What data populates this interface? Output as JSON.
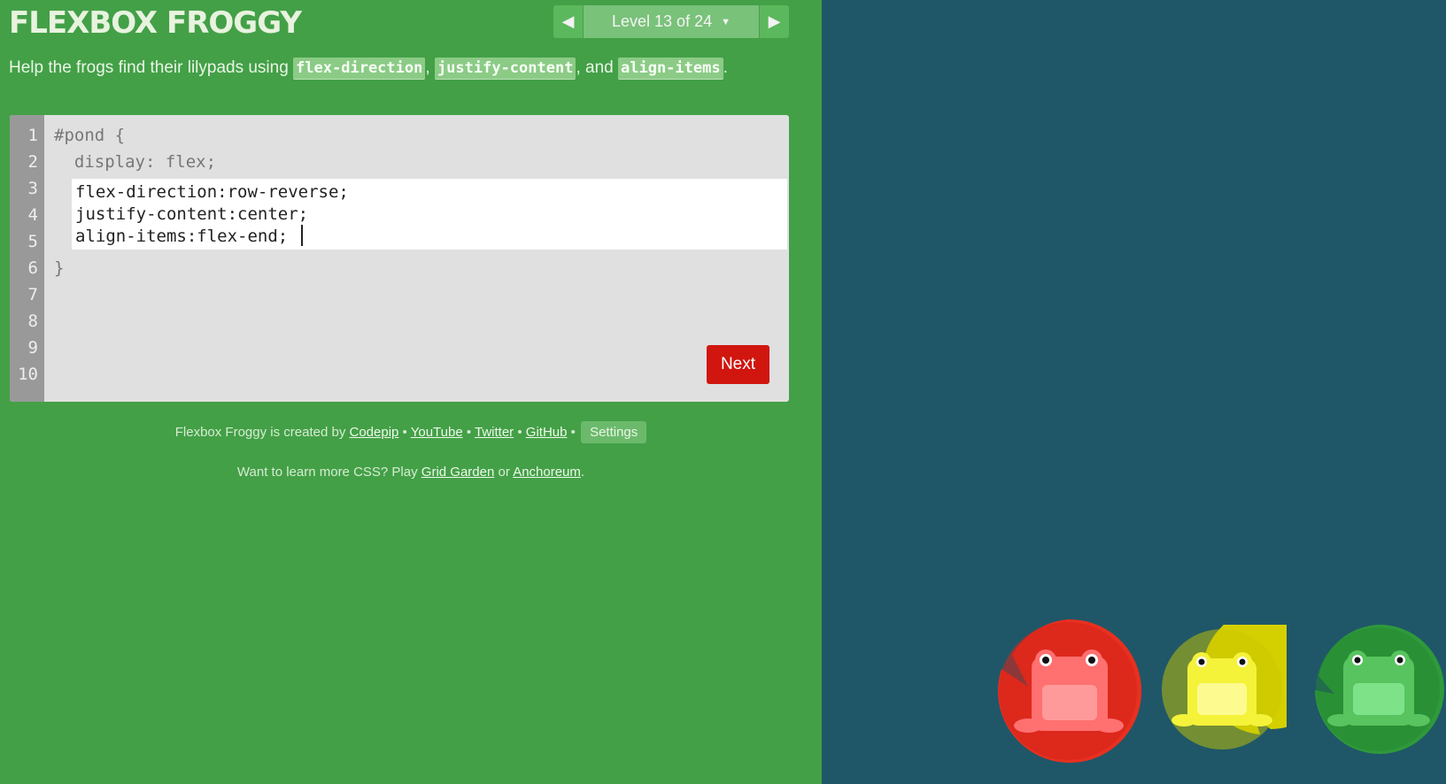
{
  "header": {
    "logo": "FLEXBOX FROGGY",
    "level_indicator": "Level 13 of 24"
  },
  "instructions": {
    "prefix": "Help the frogs find their lilypads using ",
    "prop1": "flex-direction",
    "sep1": ", ",
    "prop2": "justify-content",
    "sep2": ", and ",
    "prop3": "align-items",
    "suffix": "."
  },
  "editor": {
    "line_numbers": [
      "1",
      "2",
      "3",
      "4",
      "5",
      "6",
      "7",
      "8",
      "9",
      "10"
    ],
    "line1": "#pond {",
    "line2": "  display: flex;",
    "input_lines": [
      "flex-direction:row-reverse;",
      "justify-content:center;",
      "align-items:flex-end;"
    ],
    "line6": "}",
    "next_label": "Next"
  },
  "footer": {
    "created_by": "Flexbox Froggy is created by ",
    "link_codepip": "Codepip",
    "bullet": " • ",
    "link_youtube": "YouTube",
    "link_twitter": "Twitter",
    "link_github": "GitHub",
    "settings_label": "Settings",
    "learn_more": "Want to learn more CSS? Play ",
    "link_grid_garden": "Grid Garden",
    "or": " or ",
    "link_anchoreum": "Anchoreum",
    "period": "."
  },
  "colors": {
    "sidebar_bg": "#43a047",
    "pond_bg": "#1f5768",
    "next_button": "#d0160f",
    "frog_red": "#e8301f",
    "frog_yellow": "#d4d000",
    "frog_green": "#2e9a3a"
  },
  "pond": {
    "frogs": [
      {
        "color": "red"
      },
      {
        "color": "yellow"
      },
      {
        "color": "green"
      }
    ]
  }
}
